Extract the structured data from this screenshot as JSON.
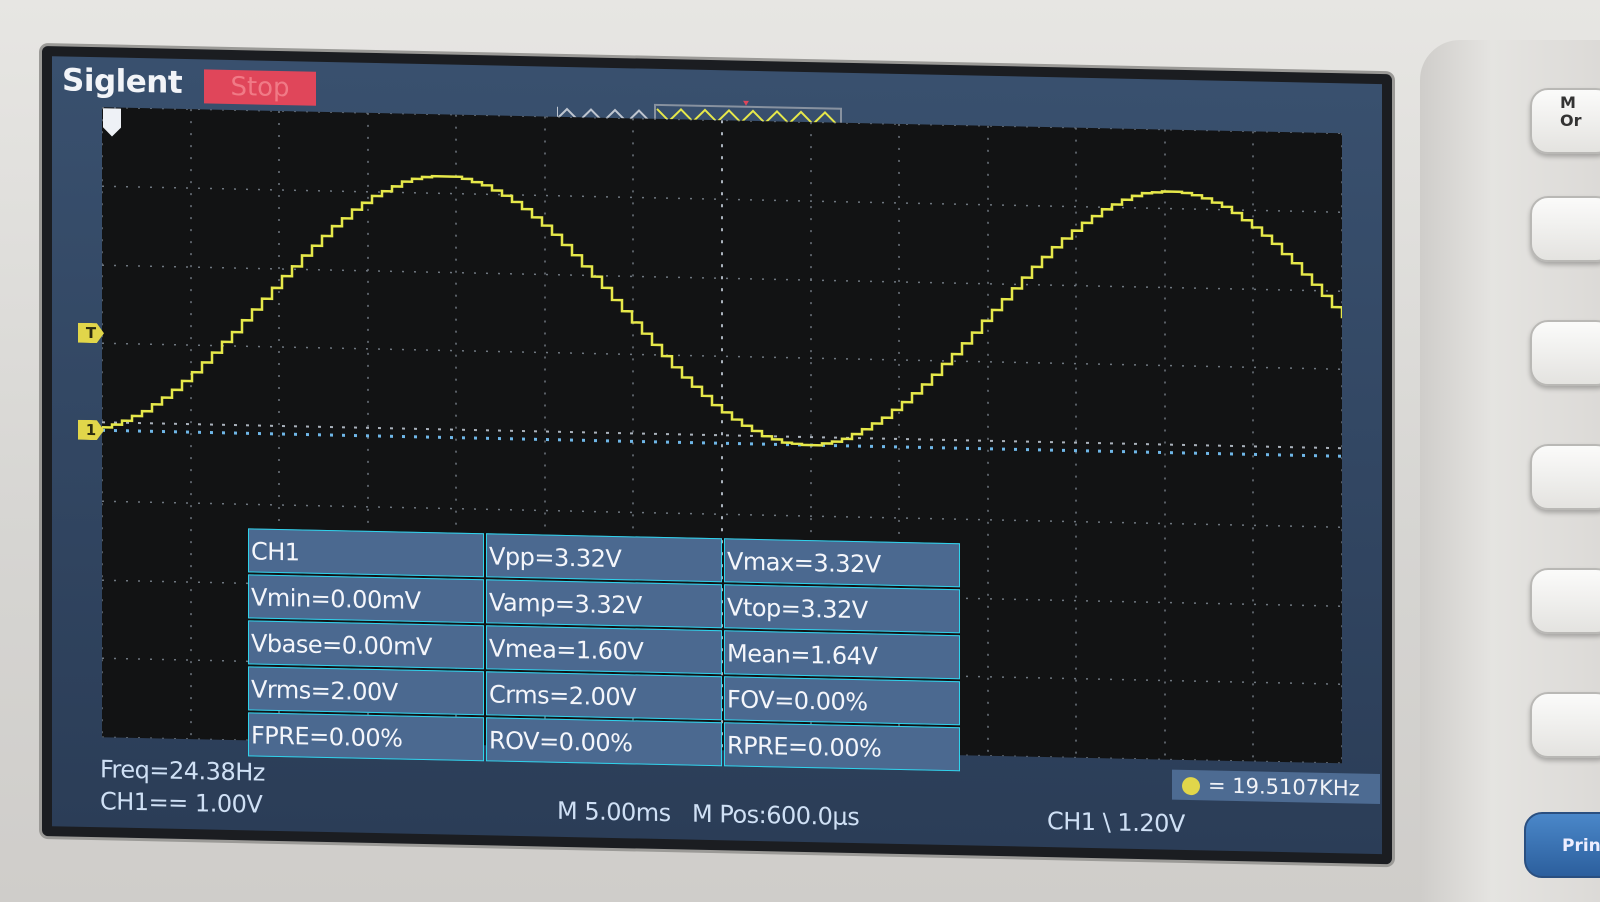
{
  "brand": "Siglent",
  "run_state": "Stop",
  "colors": {
    "trace": "#e6e84a",
    "table_bg": "#4b6990",
    "table_border": "#2fd3ec",
    "run_state": "#e0465a"
  },
  "icons": {
    "channel_marker": "1",
    "trigger_level_marker": "T"
  },
  "measurements": {
    "rows": [
      [
        "CH1",
        "Vpp=3.32V",
        "Vmax=3.32V"
      ],
      [
        "Vmin=0.00mV",
        "Vamp=3.32V",
        "Vtop=3.32V"
      ],
      [
        "Vbase=0.00mV",
        "Vmea=1.60V",
        "Mean=1.64V"
      ],
      [
        "Vrms=2.00V",
        "Crms=2.00V",
        "FOV=0.00%"
      ],
      [
        "FPRE=0.00%",
        "ROV=0.00%",
        "RPRE=0.00%"
      ]
    ]
  },
  "freq_counter": "= 19.5107KHz",
  "status": {
    "freq": "Freq=24.38Hz",
    "ch1_scale": "CH1== 1.00V",
    "timebase": "M 5.00ms",
    "mpos": "M Pos:600.0µs",
    "trigger": "CH1 \\ 1.20V"
  }
}
